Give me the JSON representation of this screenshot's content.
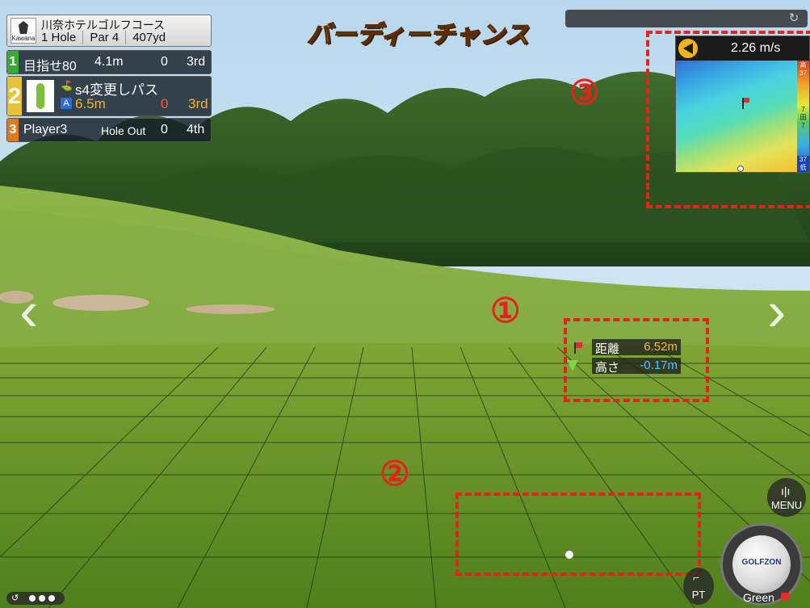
{
  "banner": "バーディーチャンス",
  "course": {
    "name": "川奈ホテルゴルフコース",
    "logo_text": "Kawana",
    "hole": "1 Hole",
    "par": "Par 4",
    "yards": "407yd"
  },
  "players": [
    {
      "rank": "1",
      "name": "目指せ80",
      "distance": "4.1m",
      "score": "0",
      "place": "3rd",
      "rank_color": "#3aa935"
    },
    {
      "rank": "2",
      "name": "s4変更しパス",
      "aim": "A",
      "distance": "6.5m",
      "score": "0",
      "place": "3rd",
      "rank_color": "#e9c23a"
    },
    {
      "rank": "3",
      "name": "Player3",
      "status": "Hole Out",
      "score": "0",
      "place": "4th",
      "rank_color": "#e07a1f"
    }
  ],
  "wind": {
    "speed": "2.26 m/s"
  },
  "slope_legend": {
    "high": "高",
    "low": "低",
    "top_value": "37",
    "bottom_value": "37",
    "mid_values": [
      "7",
      "田",
      "7"
    ]
  },
  "pin_info": {
    "distance_label": "距離",
    "distance_value": "6.52m",
    "height_label": "高さ",
    "height_value": "-0.17m"
  },
  "annotations": {
    "one": "①",
    "two": "②",
    "three": "③"
  },
  "controls": {
    "menu": "MENU",
    "putter": "PT",
    "ball_brand": "GOLFZON",
    "lie": "Green",
    "nav_left": "‹",
    "nav_right": "›"
  },
  "icons": {
    "refresh": "refresh-icon",
    "menu": "menu-bars-icon",
    "putter": "putter-icon",
    "replay": "replay-icon",
    "wind": "wind-direction-icon"
  },
  "colors": {
    "annotation": "#e8221a",
    "accent": "#f2b63c",
    "height_value": "#4ec8ff"
  }
}
